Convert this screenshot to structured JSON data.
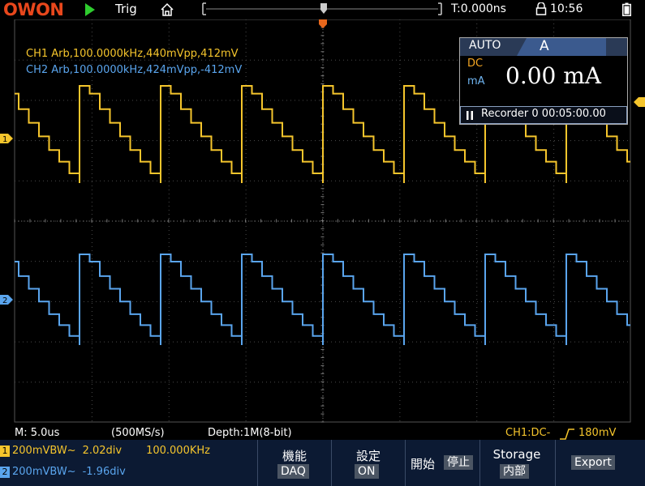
{
  "topbar": {
    "logo": "OWON",
    "trig": "Trig",
    "time_position": "T:0.000ns",
    "clock": "10:56"
  },
  "channels": {
    "ch1": {
      "info": "CH1 Arb,100.0000kHz,440mVpp,412mV",
      "marker": "1",
      "color": "#f5c52c"
    },
    "ch2": {
      "info": "CH2 Arb,100.0000kHz,424mVpp,-412mV",
      "marker": "2",
      "color": "#5aa5ee"
    }
  },
  "meter": {
    "mode": "AUTO",
    "tab": "A",
    "coupling": "DC",
    "unit": "mA",
    "value": "0.00 mA",
    "recorder": "Recorder 0 00:05:00.00"
  },
  "status": {
    "timebase": "M: 5.0us",
    "sample_rate": "(500MS/s)",
    "depth": "Depth:1M(8-bit)",
    "trigger": "CH1:DC-",
    "trigger_level": "180mV"
  },
  "bottom": {
    "ch1": {
      "badge": "1",
      "scale": "200mV",
      "bw": "BW~",
      "offset": "2.02div",
      "freq": "100.000KHz"
    },
    "ch2": {
      "badge": "2",
      "scale": "200mV",
      "bw": "BW~",
      "offset": "-1.96div"
    },
    "menus": [
      {
        "title": "機能",
        "value": "DAQ"
      },
      {
        "title": "設定",
        "value": "ON"
      },
      {
        "title": "開始",
        "value": "停止"
      },
      {
        "title": "Storage",
        "value": "内部"
      },
      {
        "title": "",
        "value": "Export"
      }
    ]
  },
  "icons": {
    "run": "play-icon",
    "home": "home-icon",
    "lock": "lock-icon",
    "battery": "battery-icon",
    "pause": "pause-icon"
  }
}
